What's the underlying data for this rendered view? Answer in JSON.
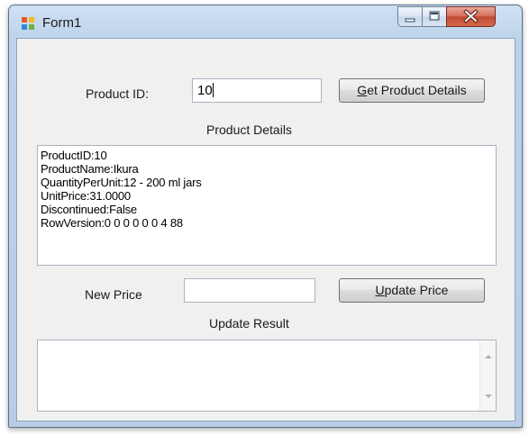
{
  "window": {
    "title": "Form1"
  },
  "form": {
    "product_id_label": "Product ID:",
    "product_id_value": "10",
    "get_button_prefix": "",
    "get_button_mnemonic": "G",
    "get_button_rest": "et Product Details",
    "product_details_label": "Product Details",
    "details_lines": [
      "ProductID:10",
      "ProductName:Ikura",
      "QuantityPerUnit:12 - 200 ml jars",
      "UnitPrice:31.0000",
      "Discontinued:False",
      "RowVersion:0 0 0 0 0 0 4 88"
    ],
    "new_price_label": "New Price",
    "new_price_value": "",
    "update_button_mnemonic": "U",
    "update_button_rest": "pdate Price",
    "update_result_label": "Update Result",
    "update_result_value": ""
  },
  "icons": {
    "app": "windows-form-icon",
    "minimize": "minimize-icon",
    "maximize": "maximize-icon",
    "close": "close-icon"
  },
  "colors": {
    "titlebar": "#bcd2ea",
    "client_bg": "#f0f0f0",
    "close_button": "#c24a31"
  }
}
